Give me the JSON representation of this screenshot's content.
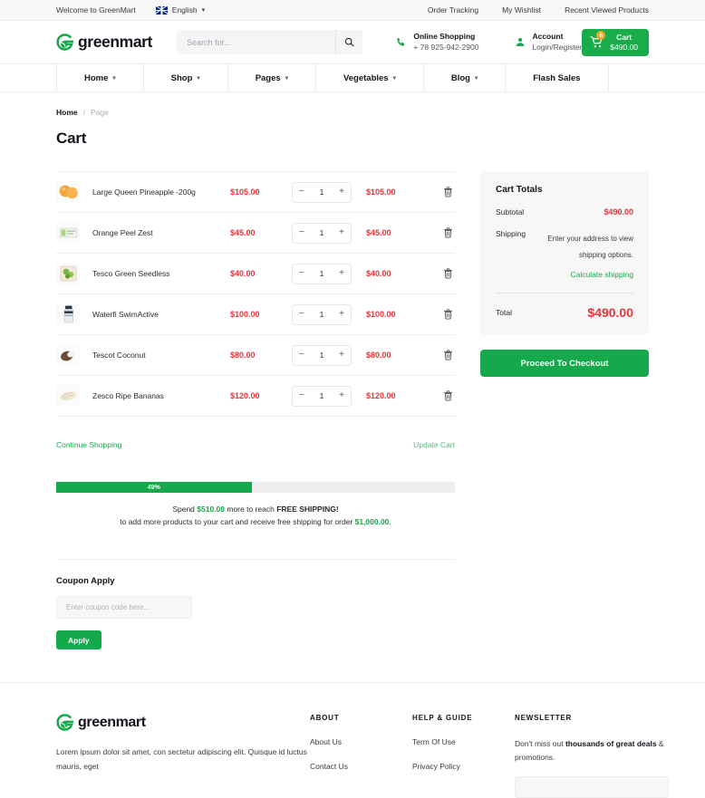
{
  "topbar": {
    "welcome": "Welcome to GreenMart",
    "language": "English",
    "links": [
      {
        "label": "Order Tracking"
      },
      {
        "label": "My Wishlist"
      },
      {
        "label": "Recent Viewed Products"
      }
    ]
  },
  "header": {
    "brand": "greenmart",
    "search": {
      "value": "",
      "placeholder": "Search for..."
    },
    "phone": {
      "title": "Online Shopping",
      "number": "+ 78 925-942-2900"
    },
    "account": {
      "title": "Account",
      "subtitle": "Login/Register"
    },
    "cart": {
      "label": "Cart",
      "amount": "$490.00",
      "count": "6"
    }
  },
  "nav": {
    "items": [
      {
        "label": "Home",
        "has_caret": true
      },
      {
        "label": "Shop",
        "has_caret": true
      },
      {
        "label": "Pages",
        "has_caret": true
      },
      {
        "label": "Vegetables",
        "has_caret": true
      },
      {
        "label": "Blog",
        "has_caret": true
      },
      {
        "label": "Flash Sales",
        "has_caret": false
      }
    ]
  },
  "breadcrumb": {
    "home": "Home",
    "separator": "/",
    "current": "Page"
  },
  "page_title": "Cart",
  "cart": {
    "rows": [
      {
        "name": "Large Queen Pineapple -200g",
        "price": "$105.00",
        "qty": "1",
        "subtotal": "$105.00",
        "thumb": "pineapple-thumb"
      },
      {
        "name": "Orange Peel Zest",
        "price": "$45.00",
        "qty": "1",
        "subtotal": "$45.00",
        "thumb": "orange-peel-thumb"
      },
      {
        "name": "Tesco Green Seedless",
        "price": "$40.00",
        "qty": "1",
        "subtotal": "$40.00",
        "thumb": "green-seedless-thumb"
      },
      {
        "name": "Waterfi SwimActive",
        "price": "$100.00",
        "qty": "1",
        "subtotal": "$100.00",
        "thumb": "swimactive-thumb"
      },
      {
        "name": "Tescot Coconut",
        "price": "$80.00",
        "qty": "1",
        "subtotal": "$80.00",
        "thumb": "coconut-thumb"
      },
      {
        "name": "Zesco Ripe Bananas",
        "price": "$120.00",
        "qty": "1",
        "subtotal": "$120.00",
        "thumb": "bananas-thumb"
      }
    ],
    "decrement_label": "−",
    "increment_label": "+",
    "continue_shopping": "Continue Shopping",
    "update_cart": "Update Cart"
  },
  "progress": {
    "percent_label": "49%",
    "percent_value": 49,
    "line1_pre": "Spend ",
    "line1_amount": "$510.00",
    "line1_mid": " more to reach ",
    "line1_strong": "FREE SHIPPING!",
    "line2_pre": "to add more products to your cart and receive free shipping for order ",
    "line2_amount": "$1,000.00",
    "line2_post": "."
  },
  "coupon": {
    "title": "Coupon Apply",
    "value": "",
    "placeholder": "Enter coupon code here...",
    "apply_label": "Apply"
  },
  "totals": {
    "title": "Cart Totals",
    "subtotal_label": "Subtotal",
    "subtotal_value": "$490.00",
    "shipping_label": "Shipping",
    "shipping_note": "Enter your address to view shipping options.",
    "calculate_link": "Calculate shipping",
    "total_label": "Total",
    "total_value": "$490.00",
    "checkout_label": "Proceed To Checkout"
  },
  "footer": {
    "brand": "greenmart",
    "description": "Lorem ipsum dolor sit amet, con sectetur adipiscing elit. Quisque id luctus mauris, eget",
    "about": {
      "heading": "ABOUT",
      "links": [
        {
          "label": "About Us"
        },
        {
          "label": "Contact Us"
        }
      ]
    },
    "help": {
      "heading": "HELP & GUIDE",
      "links": [
        {
          "label": "Term Of Use"
        },
        {
          "label": "Privacy Policy"
        }
      ]
    },
    "newsletter": {
      "heading": "NEWSLETTER",
      "text_pre": "Don't miss out ",
      "text_strong": "thousands of great deals",
      "text_post": " & promotions.",
      "input_value": "",
      "input_placeholder": ""
    }
  },
  "colors": {
    "brand_green": "#16a94c",
    "cart_green": "#1aab4b",
    "price_red": "#e8353b",
    "badge_orange": "#f5a623",
    "text_dark": "#14141c",
    "track_gray": "#eeeef0"
  }
}
